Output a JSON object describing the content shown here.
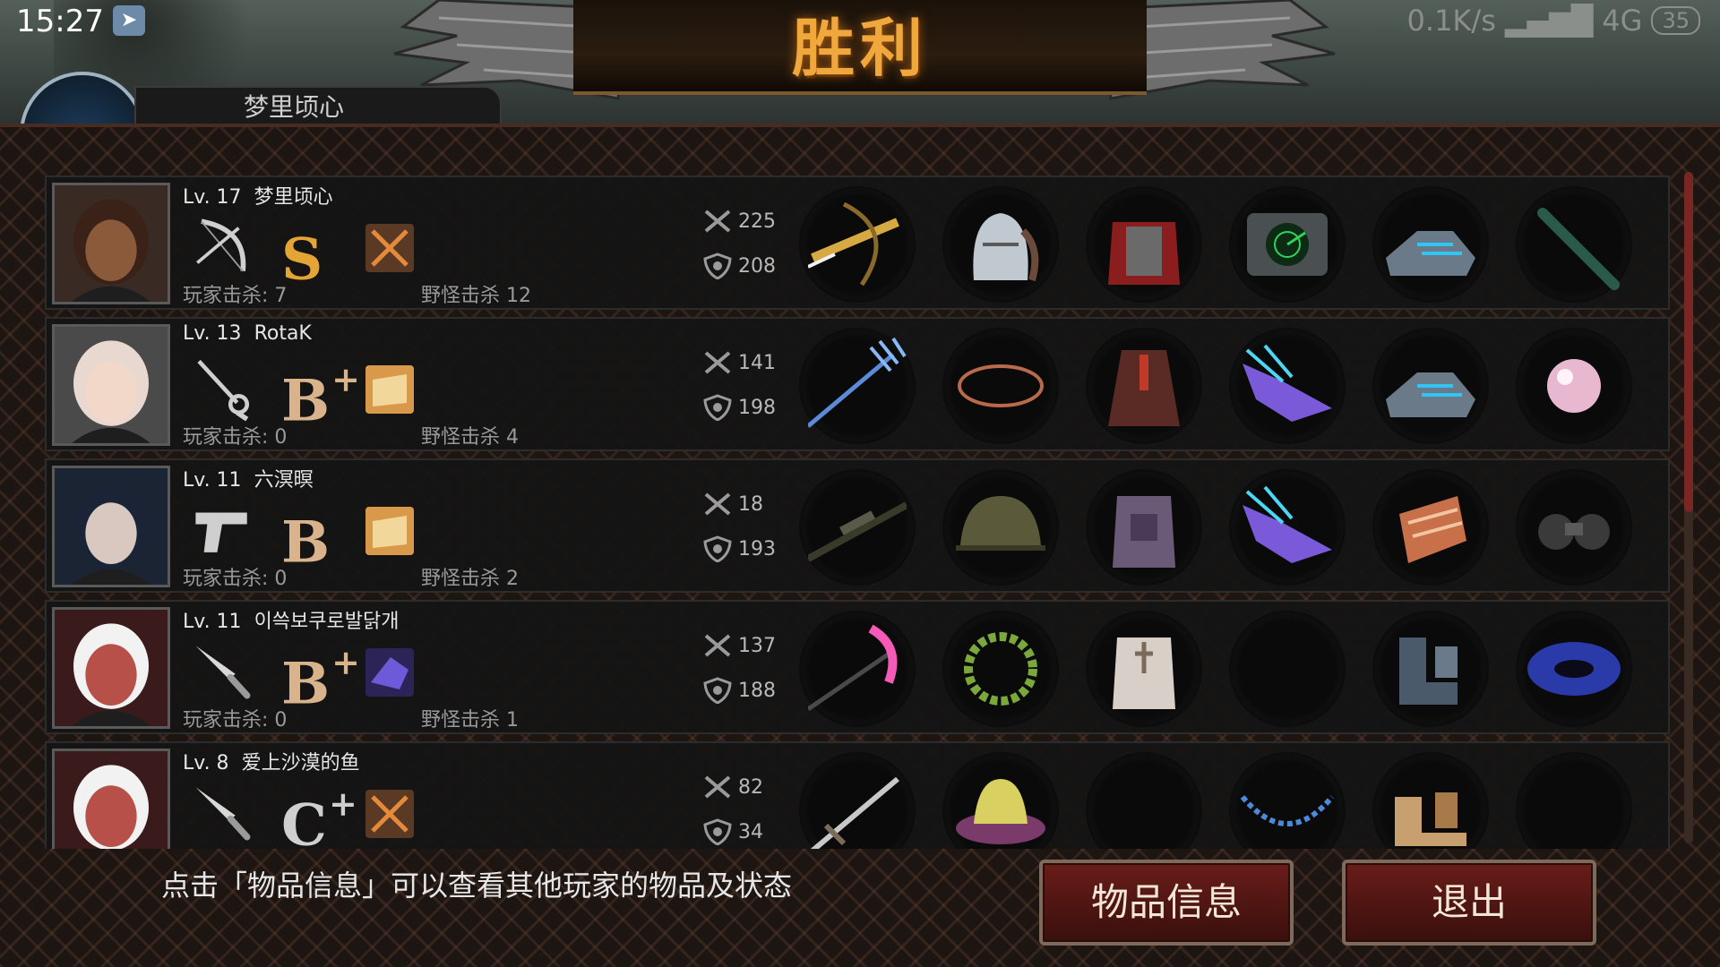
{
  "status_bar": {
    "time": "15:27",
    "network_speed": "0.1K/s",
    "signal": "4G",
    "battery": "35"
  },
  "banner": {
    "title": "胜利"
  },
  "top_player": {
    "name_partial": "梦里顷心"
  },
  "colors": {
    "grade_s": "#e5a534",
    "grade_b": "#d9b38c",
    "grade_c": "#cfcfcf",
    "button_red": "#5a1a16",
    "title_gold": "#f0a83c"
  },
  "players": [
    {
      "level": "Lv. 17",
      "name": "梦里顷心",
      "weapon": "bow-icon",
      "grade": "S",
      "grade_plus": "",
      "special": "crossed-swords-box-icon",
      "player_kills_label": "玩家击杀: 7",
      "monster_kills_label": "野怪击杀 12",
      "kills": "225",
      "defense": "208",
      "items": [
        "crossbow-icon",
        "knight-helmet-icon",
        "red-armor-icon",
        "radar-device-icon",
        "blue-sneakers-icon",
        "flute-icon"
      ]
    },
    {
      "level": "Lv. 13",
      "name": "RotaK",
      "weapon": "rapier-icon",
      "grade": "B",
      "grade_plus": "+",
      "special": "leather-box-icon",
      "player_kills_label": "玩家击杀: 0",
      "monster_kills_label": "野怪击杀 4",
      "kills": "141",
      "defense": "198",
      "items": [
        "trident-icon",
        "copper-ring-icon",
        "red-robe-icon",
        "purple-dragon-claw-icon",
        "blue-sneakers-icon",
        "pink-pearl-icon"
      ]
    },
    {
      "level": "Lv. 11",
      "name": "六溟暝",
      "weapon": "pistol-icon",
      "grade": "B",
      "grade_plus": "",
      "special": "leather-box-icon",
      "player_kills_label": "玩家击杀: 0",
      "monster_kills_label": "野怪击杀 2",
      "kills": "18",
      "defense": "193",
      "items": [
        "sniper-rifle-icon",
        "army-helmet-icon",
        "purple-plate-armor-icon",
        "purple-dragon-claw-icon",
        "bracer-icon",
        "binoculars-icon"
      ]
    },
    {
      "level": "Lv. 11",
      "name": "이쓱보쿠로발닭개",
      "weapon": "knife-icon",
      "grade": "B",
      "grade_plus": "+",
      "special": "purple-box-icon",
      "player_kills_label": "玩家击杀: 0",
      "monster_kills_label": "野怪击杀 1",
      "kills": "137",
      "defense": "188",
      "items": [
        "pink-axe-icon",
        "laurel-wreath-icon",
        "white-armor-icon",
        "empty-slot",
        "steel-boots-icon",
        "galaxy-icon"
      ]
    },
    {
      "level": "Lv. 8",
      "name": "爱上沙漠的鱼",
      "weapon": "knife-icon",
      "grade": "C",
      "grade_plus": "+",
      "special": "crossed-swords-box-icon",
      "player_kills_label": "",
      "monster_kills_label": "",
      "kills": "82",
      "defense": "34",
      "items": [
        "long-sword-icon",
        "sun-hat-icon",
        "empty-slot",
        "bead-necklace-icon",
        "bone-boots-icon",
        "empty-slot"
      ]
    }
  ],
  "footer": {
    "hint": "点击「物品信息」可以查看其他玩家的物品及状态",
    "info_button": "物品信息",
    "exit_button": "退出"
  }
}
